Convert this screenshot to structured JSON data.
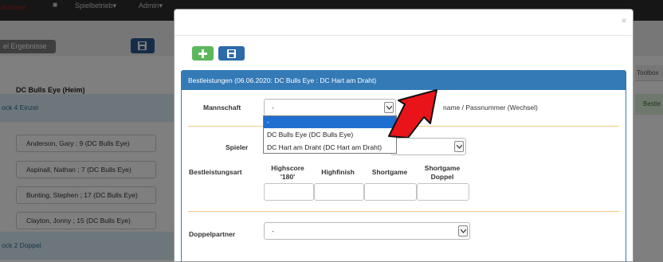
{
  "navbar": {
    "brand": "Bullseye",
    "home_icon": "home-icon",
    "menu_spielbetrieb": "Spielbetrieb▾",
    "menu_admin": "Admin▾"
  },
  "background": {
    "results_button": "el Ergebnisse",
    "save_icon": "save-icon",
    "toolbox": "Toolbox",
    "bestle": "Bestle",
    "team_heading": "DC Bulls Eye (Heim)",
    "block_single": "ock 4 Einzel",
    "block_double": "ock 2 Doppel",
    "players": [
      "Anderson, Gary ; 9 (DC Bulls Eye)",
      "Aspinall, Nathan ; 7 (DC Bulls Eye)",
      "Bunting, Stephen ; 17 (DC Bulls Eye)",
      "Clayton, Jonny ; 15 (DC Bulls Eye)"
    ]
  },
  "modal": {
    "close": "×",
    "add_icon": "plus-icon",
    "save_icon": "save-icon",
    "panel_title": "Bestleistungen (06.06.2020: DC Bulls Eye : DC Hart am Draht)",
    "mannschaft_label": "Mannschaft",
    "mannschaft_value": "-",
    "side_text": "name / Passnummer (Wechsel)",
    "spieler_label": "Spieler",
    "bestleistungsart_label": "Bestleistungsart",
    "col_highscore_line1": "Highscore",
    "col_highscore_line2": "'180'",
    "col_highfinish": "Highfinish",
    "col_shortgame": "Shortgame",
    "col_shortgame_doppel_line1": "Shortgame",
    "col_shortgame_doppel_line2": "Doppel",
    "doppelpartner_label": "Doppelpartner",
    "doppelpartner_value": "-",
    "dropdown_options": [
      "-",
      "DC Bulls Eye (DC Bulls Eye)",
      "DC Hart am Draht (DC Hart am Draht)"
    ],
    "dropdown_selected_index": 0,
    "arrow_color": "#e8141a"
  },
  "colors": {
    "primary": "#337ab7",
    "success": "#5cb85c",
    "divider": "#f3c98a"
  }
}
